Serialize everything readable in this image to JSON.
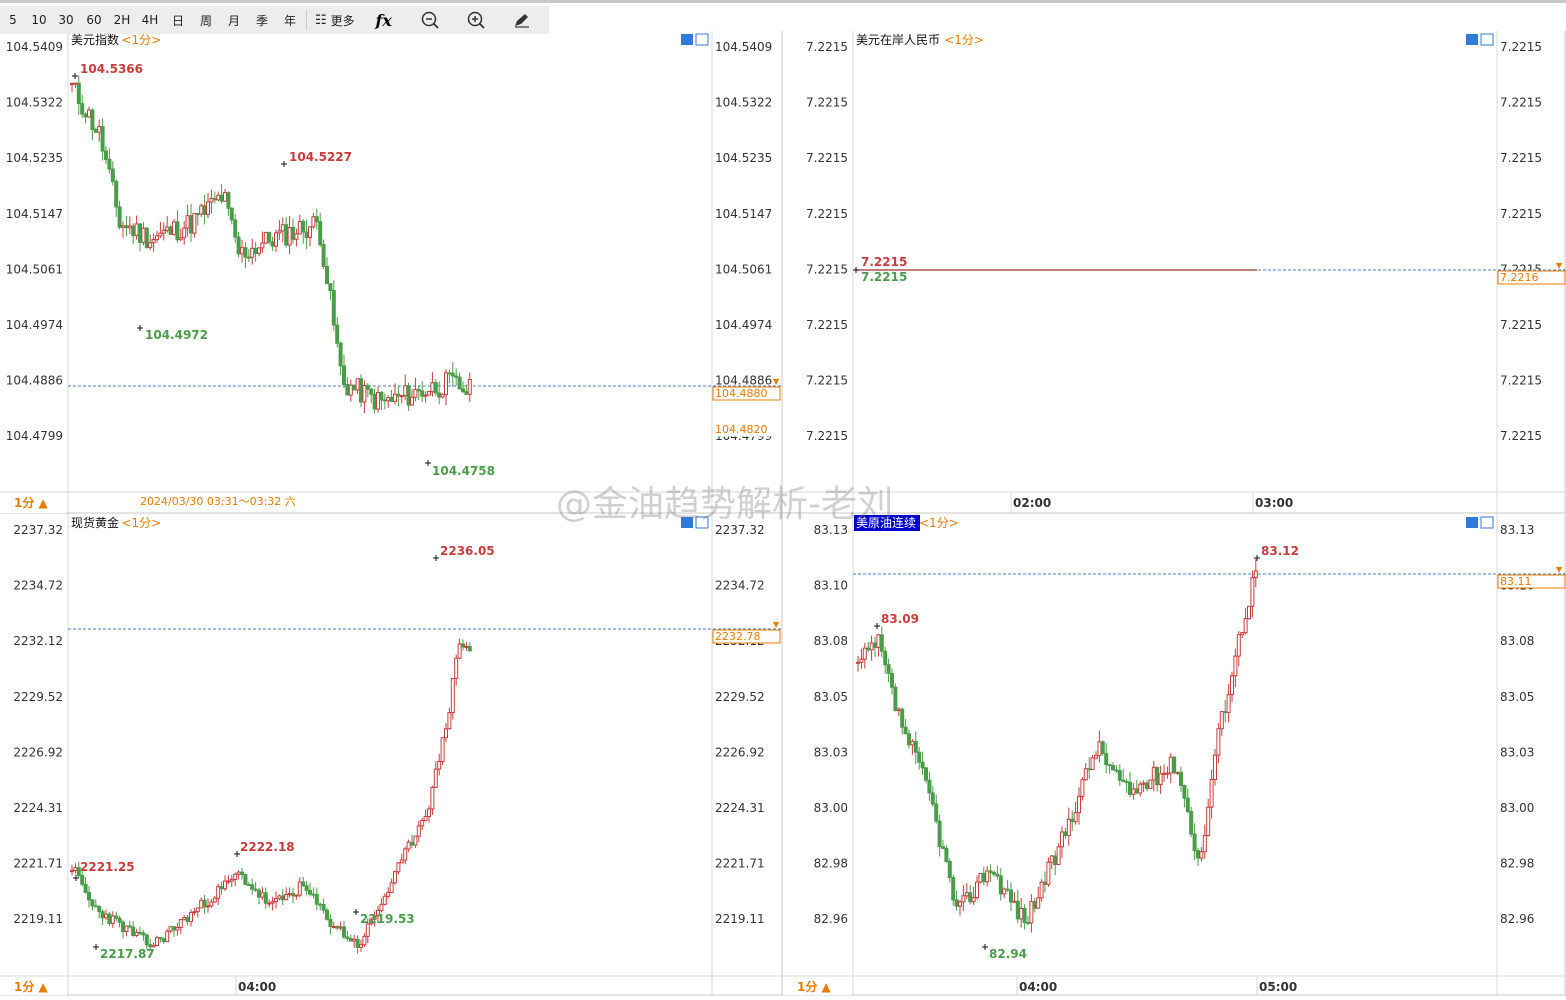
{
  "toolbar": {
    "periods": [
      "5",
      "10",
      "30",
      "60",
      "2H",
      "4H",
      "日",
      "周",
      "月",
      "季",
      "年"
    ],
    "more_label": "更多",
    "fx_label": "fx",
    "icons": [
      "list-icon",
      "fx-icon",
      "zoom-out-icon",
      "zoom-in-icon",
      "draw-pen-icon"
    ]
  },
  "watermark": "@金油趋势解析-老刘",
  "colors": {
    "up": "#c83c3c",
    "down": "#4a9c4a",
    "price_line": "#4a7fc8",
    "price_tag": "#e87c00",
    "grid": "#e6e6e6",
    "sel_bg": "#0000cc"
  },
  "period_tag": "1分",
  "panels": [
    {
      "id": "dxy",
      "name": "美元指数",
      "period": "<1分>",
      "title_selected": false,
      "ticks": [
        "104.5409",
        "104.5322",
        "104.5235",
        "104.5147",
        "104.5061",
        "104.4974",
        "104.4886",
        "104.4799"
      ],
      "ymin": 104.4758,
      "ymax": 104.5409,
      "right_tag": "104.4880",
      "right_tag2": "104.4820",
      "current": 104.488,
      "high_label": "104.5366",
      "low_label": "104.4758",
      "mid_high_label": "104.5227",
      "mid_low_label": "104.4972",
      "bottom_info": "2024/03/30 03:31～03:32 六",
      "x_labels": []
    },
    {
      "id": "cnh",
      "name": "美元在岸人民币",
      "period": "<1分>",
      "title_selected": false,
      "ticks": [
        "7.2215",
        "7.2215",
        "7.2215",
        "7.2215",
        "7.2215",
        "7.2215",
        "7.2215",
        "7.2215"
      ],
      "ymin": 7.2214,
      "ymax": 7.2216,
      "right_tag": "7.2216",
      "current": 7.2215,
      "high_label": "7.2215",
      "low_label": "7.2215",
      "bottom_info": "",
      "x_labels": [
        "02:00",
        "03:00"
      ]
    },
    {
      "id": "gold",
      "name": "现货黄金",
      "period": "<1分>",
      "title_selected": false,
      "ticks": [
        "2237.32",
        "2234.72",
        "2232.12",
        "2229.52",
        "2226.92",
        "2224.31",
        "2221.71",
        "2219.11"
      ],
      "ymin": 2217.87,
      "ymax": 2237.32,
      "right_tag": "2232.78",
      "current": 2232.78,
      "high_label": "2236.05",
      "low_label": "2217.87",
      "mid_high_label": "2222.18",
      "mid_low_label": "2219.53",
      "left_label": "2221.25",
      "bottom_info": "",
      "x_labels": [
        "04:00"
      ]
    },
    {
      "id": "oil",
      "name": "美原油连续",
      "period": "<1分>",
      "title_selected": true,
      "ticks": [
        "83.13",
        "83.10",
        "83.08",
        "83.05",
        "83.03",
        "83.00",
        "82.98",
        "82.96"
      ],
      "ymin": 82.94,
      "ymax": 83.13,
      "right_tag": "83.11",
      "current": 83.11,
      "high_label": "83.12",
      "low_label": "82.94",
      "mid_high_label": "83.09",
      "bottom_info": "",
      "x_labels": [
        "04:00",
        "05:00"
      ]
    }
  ],
  "chart_data": [
    {
      "type": "candlestick",
      "title": "美元指数",
      "y_ticks": [
        104.5409,
        104.5322,
        104.5235,
        104.5147,
        104.5061,
        104.4974,
        104.4886,
        104.4799
      ],
      "ylim": [
        104.4758,
        104.5409
      ],
      "high": 104.5366,
      "low": 104.4758,
      "last": 104.488
    },
    {
      "type": "line",
      "title": "美元在岸人民币",
      "y_ticks": [
        7.2215
      ],
      "ylim": [
        7.2215,
        7.2215
      ],
      "high": 7.2215,
      "low": 7.2215,
      "last": 7.2216,
      "x_ticks": [
        "02:00",
        "03:00"
      ]
    },
    {
      "type": "candlestick",
      "title": "现货黄金",
      "y_ticks": [
        2237.32,
        2234.72,
        2232.12,
        2229.52,
        2226.92,
        2224.31,
        2221.71,
        2219.11
      ],
      "ylim": [
        2217.87,
        2237.32
      ],
      "high": 2236.05,
      "low": 2217.87,
      "last": 2232.78,
      "x_ticks": [
        "04:00"
      ]
    },
    {
      "type": "candlestick",
      "title": "美原油连续",
      "y_ticks": [
        83.13,
        83.1,
        83.08,
        83.05,
        83.03,
        83.0,
        82.98,
        82.96
      ],
      "ylim": [
        82.94,
        83.13
      ],
      "high": 83.12,
      "low": 82.94,
      "last": 83.11,
      "x_ticks": [
        "04:00",
        "05:00"
      ]
    }
  ]
}
